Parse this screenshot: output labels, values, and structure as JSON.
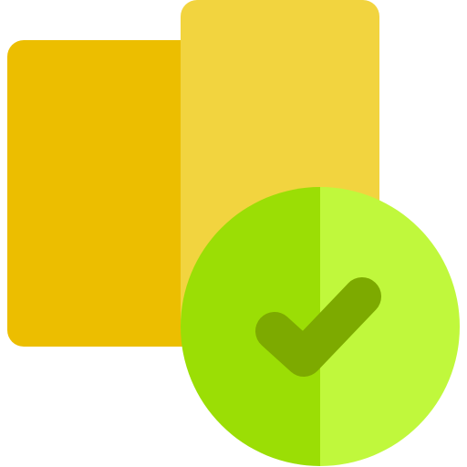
{
  "icon": {
    "name": "documents-approved-icon",
    "parts": {
      "back_card": "card-icon",
      "front_card": "card-icon",
      "badge": "circle-check-icon",
      "check": "checkmark-icon"
    },
    "colors": {
      "back_card": "#ECBE00",
      "front_card": "#F2D43F",
      "badge_left": "#9BDE05",
      "badge_right": "#C0F83C",
      "check": "#7DAA00"
    }
  }
}
